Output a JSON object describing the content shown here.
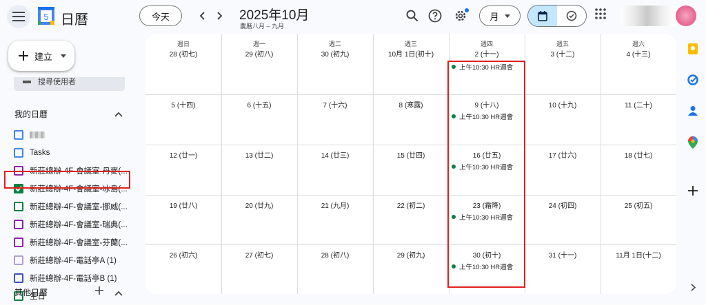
{
  "header": {
    "app_title": "日曆",
    "logo_day": "5",
    "today_label": "今天",
    "month_title": "2025年10月",
    "lunar_subtitle": "農曆八月 – 九月",
    "view_label": "月"
  },
  "sidebar": {
    "create_label": "建立",
    "search_people": "搜尋使用者",
    "my_calendars_title": "我的日曆",
    "calendars": [
      {
        "label": "",
        "color": "#4285f4",
        "checked": false,
        "blurred": true
      },
      {
        "label": "Tasks",
        "color": "#4285f4",
        "checked": false
      },
      {
        "label": "新莊總辦-4F-會議室-丹麥(...",
        "color": "#8e24aa",
        "checked": false
      },
      {
        "label": "新莊總辦-4F-會議室-冰島(...",
        "color": "#0b8043",
        "checked": true
      },
      {
        "label": "新莊總辦-4F-會議室-挪威(...",
        "color": "#0b8043",
        "checked": false
      },
      {
        "label": "新莊總辦-4F-會議室-瑞典(...",
        "color": "#8e24aa",
        "checked": false
      },
      {
        "label": "新莊總辦-4F-會議室-芬蘭(...",
        "color": "#8e24aa",
        "checked": false
      },
      {
        "label": "新莊總辦-4F-電話亭A (1)",
        "color": "#b39ddb",
        "checked": false
      },
      {
        "label": "新莊總辦-4F-電話亭B (1)",
        "color": "#3f51b5",
        "checked": false
      },
      {
        "label": "生日",
        "color": "#0b8043",
        "checked": false
      }
    ],
    "other_calendars_title": "其他日曆"
  },
  "calendar": {
    "weekdays": [
      "週日",
      "週一",
      "週二",
      "週三",
      "週四",
      "週五",
      "週六"
    ],
    "weeks": [
      [
        "28 (初七)",
        "29 (初八)",
        "30 (初九)",
        "10月 1日(初十)",
        "2 (十一)",
        "3 (十二)",
        "4 (十三)"
      ],
      [
        "5 (十四)",
        "6 (十五)",
        "7 (十六)",
        "8 (寒露)",
        "9 (十八)",
        "10 (十九)",
        "11 (二十)"
      ],
      [
        "12 (廿一)",
        "13 (廿二)",
        "14 (廿三)",
        "15 (廿四)",
        "16 (廿五)",
        "17 (廿六)",
        "18 (廿七)"
      ],
      [
        "19 (廿八)",
        "20 (廿九)",
        "21 (九月)",
        "22 (初二)",
        "23 (霜降)",
        "24 (初四)",
        "25 (初五)"
      ],
      [
        "26 (初六)",
        "27 (初七)",
        "28 (初八)",
        "29 (初九)",
        "30 (初十)",
        "31 (十一)",
        "11月 1日(十二)"
      ]
    ],
    "event_label": "上午10:30 HR週會",
    "event_color": "#0b8043"
  }
}
